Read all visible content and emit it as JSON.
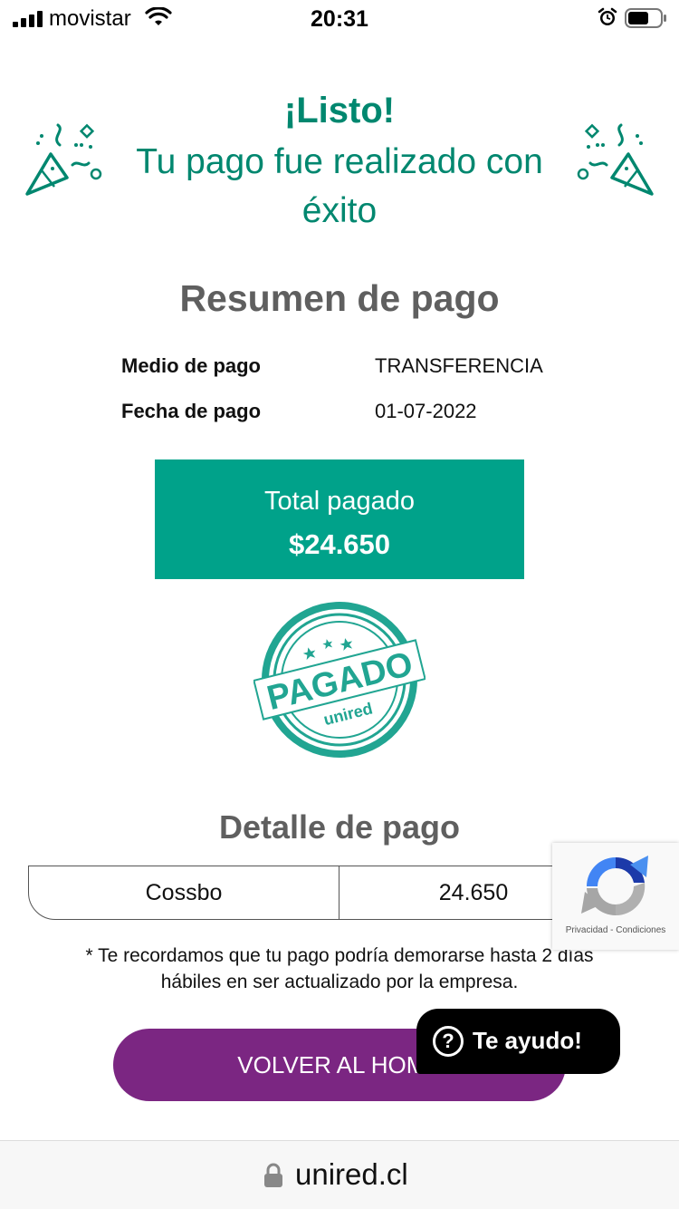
{
  "status_bar": {
    "carrier": "movistar",
    "time": "20:31"
  },
  "header": {
    "title": "¡Listo!",
    "message": "Tu pago fue realizado con éxito"
  },
  "summary": {
    "title": "Resumen de pago",
    "rows": [
      {
        "label": "Medio de pago",
        "value": "TRANSFERENCIA"
      },
      {
        "label": "Fecha de pago",
        "value": "01-07-2022"
      }
    ],
    "total_label": "Total pagado",
    "total_value": "$24.650"
  },
  "stamp": {
    "text": "PAGADO",
    "brand": "unired"
  },
  "detail": {
    "title": "Detalle de pago",
    "rows": [
      {
        "name": "Cossbo",
        "amount": "24.650"
      }
    ],
    "note": "* Te recordamos que tu pago podría demorarse hasta 2 días hábiles en ser actualizado por la empresa."
  },
  "actions": {
    "home_button": "VOLVER AL HOME",
    "help_button": "Te ayudo!"
  },
  "recaptcha": {
    "text": "Privacidad - Condiciones"
  },
  "browser": {
    "address": "unired.cl"
  },
  "colors": {
    "primary_green": "#00a28a",
    "title_green": "#00876f",
    "button_purple": "#7b2682"
  }
}
